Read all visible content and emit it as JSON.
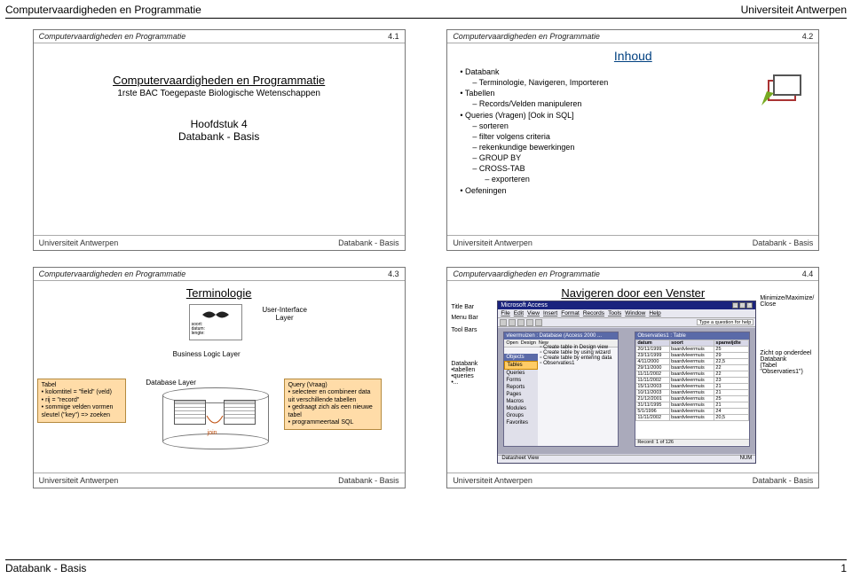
{
  "page": {
    "header_left": "Computervaardigheden en Programmatie",
    "header_right": "Universiteit Antwerpen",
    "footer_left": "Databank - Basis",
    "footer_right": "1"
  },
  "common": {
    "slide_course": "Computervaardigheden en Programmatie",
    "uni": "Universiteit Antwerpen",
    "slide_topic": "Databank - Basis"
  },
  "slide1": {
    "num": "4.1",
    "title": "Computervaardigheden en Programmatie",
    "sub": "1rste BAC Toegepaste Biologische Wetenschappen",
    "chapter": "Hoofdstuk 4",
    "topic": "Databank - Basis"
  },
  "slide2": {
    "num": "4.2",
    "title": "Inhoud",
    "items": [
      {
        "lvl": 0,
        "t": "Databank"
      },
      {
        "lvl": 1,
        "t": "Terminologie, Navigeren, Importeren"
      },
      {
        "lvl": 0,
        "t": "Tabellen"
      },
      {
        "lvl": 1,
        "t": "Records/Velden manipuleren"
      },
      {
        "lvl": 0,
        "t": "Queries (Vragen) [Ook in SQL]"
      },
      {
        "lvl": 1,
        "t": "sorteren"
      },
      {
        "lvl": 1,
        "t": "filter volgens criteria"
      },
      {
        "lvl": 1,
        "t": "rekenkundige bewerkingen"
      },
      {
        "lvl": 1,
        "t": "GROUP BY"
      },
      {
        "lvl": 1,
        "t": "CROSS-TAB"
      },
      {
        "lvl": 2,
        "t": "exporteren"
      },
      {
        "lvl": 0,
        "t": "Oefeningen"
      }
    ]
  },
  "slide3": {
    "num": "4.3",
    "title": "Terminologie",
    "layers": {
      "ui": "User-Interface Layer",
      "bl": "Business Logic Layer",
      "db": "Database Layer"
    },
    "join": "join",
    "tabel_note": [
      "Tabel",
      "kolomtitel = \"field\" (veld)",
      "rij = \"record\"",
      "sommige velden vormen sleutel (\"key\") => zoeken"
    ],
    "query_note": [
      "Query (Vraag)",
      "selecteer en combineer data uit verschillende tabellen",
      "gedraagt zich als een nieuwe tabel",
      "programmeertaal SQL"
    ],
    "mini_labels": [
      "soort",
      "datum",
      "lengte"
    ]
  },
  "slide4": {
    "num": "4.4",
    "title": "Navigeren door een Venster",
    "left_labels": {
      "titlebar": "Title Bar",
      "menubar": "Menu Bar",
      "toolbars": "Tool Bars",
      "db_panel_h": "Databank",
      "db_panel": [
        "tabellen",
        "queries",
        "..."
      ]
    },
    "right_labels": {
      "minmax": "Minimize/Maximize/ Close",
      "zicht_h": "Zicht op onderdeel Databank",
      "zicht_sub": "(Tabel \"Observaties1\")"
    },
    "access": {
      "app_title": "Microsoft Access",
      "menu": [
        "File",
        "Edit",
        "View",
        "Insert",
        "Format",
        "Records",
        "Tools",
        "Window",
        "Help"
      ],
      "ask": "Type a question for help",
      "db_title": "vleermuizen : Database (Access 2000 ...",
      "db_toolbar": [
        "Open",
        "Design",
        "New"
      ],
      "db_side_h": "Objects",
      "db_side": [
        "Tables",
        "Queries",
        "Forms",
        "Reports",
        "Pages",
        "Macros",
        "Modules",
        "Groups",
        "Favorites"
      ],
      "db_main": [
        "Create table in Design view",
        "Create table by using wizard",
        "Create table by entering data",
        "Observaties1"
      ],
      "table_title": "Observaties1 : Table",
      "table_cols": [
        "datum",
        "soort",
        "spanwijdte"
      ],
      "table_rows": [
        [
          "20/11/1999",
          "baardvleermuis",
          "25"
        ],
        [
          "23/11/1999",
          "baardvleermuis",
          "29"
        ],
        [
          "4/11/2000",
          "baardvleermuis",
          "22,5"
        ],
        [
          "29/11/2000",
          "baardvleermuis",
          "22"
        ],
        [
          "11/11/2002",
          "baardvleermuis",
          "22"
        ],
        [
          "11/11/2002",
          "baardvleermuis",
          "23"
        ],
        [
          "15/11/2003",
          "baardvleermuis",
          "21"
        ],
        [
          "10/11/2003",
          "baardvleermuis",
          "21"
        ],
        [
          "21/12/2001",
          "baardvleermuis",
          "25"
        ],
        [
          "31/11/1995",
          "baardvleermuis",
          "21"
        ],
        [
          "5/1/1996",
          "baardvleermuis",
          "24"
        ],
        [
          "11/11/2002",
          "baardvleermuis",
          "20,5"
        ]
      ],
      "record_nav": "Record: 1   of 126",
      "status_left": "Datasheet View",
      "status_right": "NUM"
    }
  }
}
